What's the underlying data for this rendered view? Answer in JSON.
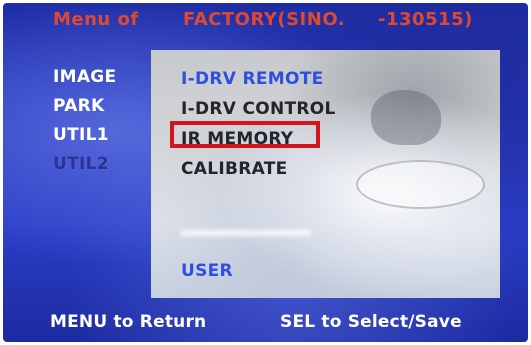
{
  "header": {
    "menu_of": "Menu of",
    "factory": "FACTORY(SINO.",
    "code": "-130515)"
  },
  "left_menu": {
    "items": [
      {
        "label": "IMAGE"
      },
      {
        "label": "PARK"
      },
      {
        "label": "UTIL1"
      },
      {
        "label": "UTIL2"
      }
    ]
  },
  "sub_menu": {
    "items": [
      {
        "label": "I-DRV REMOTE"
      },
      {
        "label": "I-DRV CONTROL"
      },
      {
        "label": "IR MEMORY"
      },
      {
        "label": "CALIBRATE"
      }
    ],
    "user_label": "USER",
    "selected": "IR MEMORY"
  },
  "footer": {
    "menu_hint": "MENU to Return",
    "sel_hint": "SEL to Select/Save"
  },
  "colors": {
    "background_blue": "#2a3cc4",
    "title_red": "#e0492f",
    "highlight_red": "#d2141e",
    "accent_blue": "#2e4fe0"
  }
}
